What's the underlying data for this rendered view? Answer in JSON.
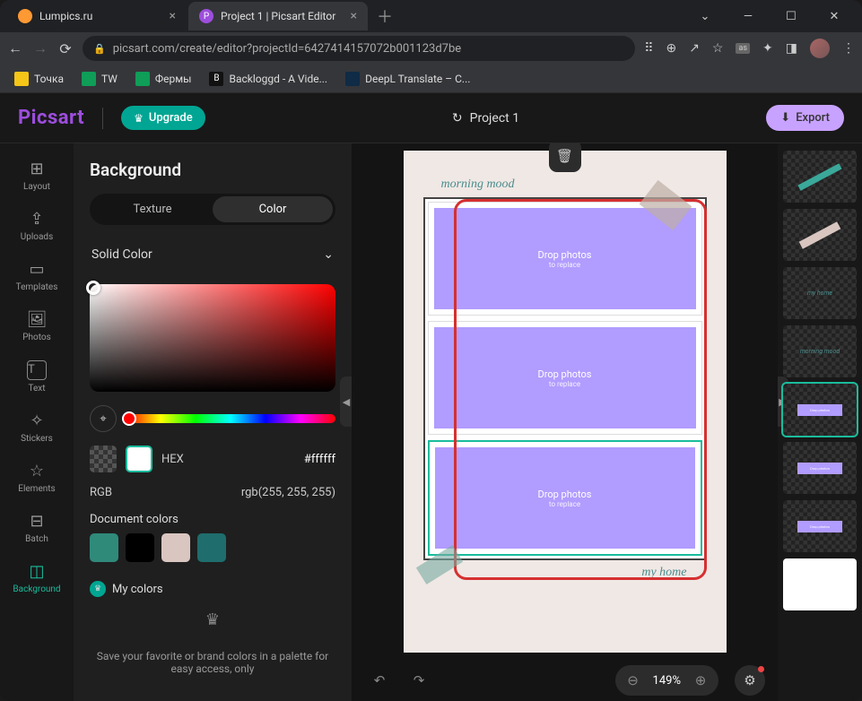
{
  "browser": {
    "tabs": [
      {
        "title": "Lumpics.ru",
        "active": false
      },
      {
        "title": "Project 1 | Picsart Editor",
        "active": true
      }
    ],
    "url": "picsart.com/create/editor?projectId=6427414157072b001123d7be",
    "bookmarks": [
      {
        "label": "Точка"
      },
      {
        "label": "TW"
      },
      {
        "label": "Фермы"
      },
      {
        "label": "Backloggd - A Vide..."
      },
      {
        "label": "DeepL Translate – С..."
      }
    ]
  },
  "app": {
    "logo": "Picsart",
    "upgrade": "Upgrade",
    "project": "Project 1",
    "export": "Export"
  },
  "tools": [
    {
      "label": "Layout",
      "icon": "⊞"
    },
    {
      "label": "Uploads",
      "icon": "⇪"
    },
    {
      "label": "Templates",
      "icon": "▭"
    },
    {
      "label": "Photos",
      "icon": "🖼"
    },
    {
      "label": "Text",
      "icon": "T"
    },
    {
      "label": "Stickers",
      "icon": "✧"
    },
    {
      "label": "Elements",
      "icon": "☆"
    },
    {
      "label": "Batch",
      "icon": "⊟"
    },
    {
      "label": "Background",
      "icon": "◫",
      "active": true
    }
  ],
  "panel": {
    "title": "Background",
    "tab_texture": "Texture",
    "tab_color": "Color",
    "solid": "Solid Color",
    "hex_label": "HEX",
    "hex_value": "#ffffff",
    "rgb_label": "RGB",
    "rgb_value": "rgb(255, 255, 255)",
    "doc_colors_label": "Document colors",
    "doc_colors": [
      "#2f8a7a",
      "#000000",
      "#d9c6c0",
      "#1f6d6d"
    ],
    "my_colors": "My colors",
    "save_hint": "Save your favorite or brand colors in a palette for easy access, only"
  },
  "canvas": {
    "morning": "morning mood",
    "myhome": "my home",
    "drop": "Drop photos",
    "replace": "to replace",
    "zoom": "149%"
  },
  "layers": {
    "myhome": "my home",
    "morning": "morning mood",
    "drop": "Drop photos"
  }
}
